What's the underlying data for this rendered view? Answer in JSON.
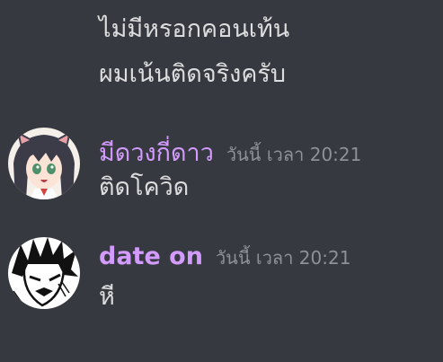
{
  "messages": {
    "continued": [
      {
        "text": "ไม่มีหรอกคอนเท้น"
      },
      {
        "text": "ผมเน้นติดจริงครับ"
      }
    ],
    "groups": [
      {
        "username": "มีดวงกี่ดาว",
        "timestamp": "วันนี้ เวลา 20:21",
        "text": "ติดโควิด",
        "avatar": "anime-girl-avatar"
      },
      {
        "username": "date on",
        "timestamp": "วันนี้ เวลา 20:21",
        "text": "หี",
        "avatar": "manga-character-avatar"
      }
    ]
  },
  "colors": {
    "background": "#36393f",
    "username": "#d29bfd",
    "text": "#dcddde",
    "timestamp": "#8e9297"
  }
}
